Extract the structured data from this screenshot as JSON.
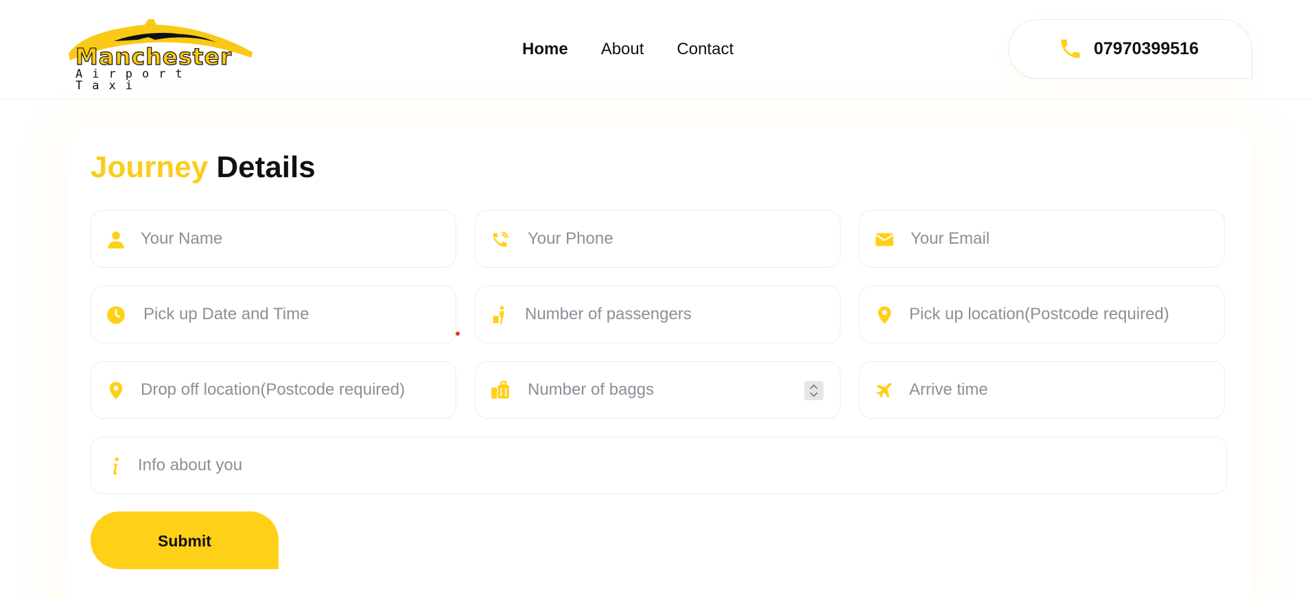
{
  "colors": {
    "accent": "#ffd018",
    "title_accent": "#fbcd1a",
    "placeholder": "#8b8f97"
  },
  "logo": {
    "title": "Manchester",
    "subtitle": "Airport Taxi"
  },
  "nav": [
    {
      "label": "Home",
      "active": true
    },
    {
      "label": "About",
      "active": false
    },
    {
      "label": "Contact",
      "active": false
    }
  ],
  "phone": {
    "icon": "phone-icon",
    "number": "07970399516"
  },
  "form": {
    "title_accent": "Journey",
    "title_rest": "Details",
    "fields": {
      "name": {
        "icon": "user-icon",
        "placeholder": "Your Name"
      },
      "phone": {
        "icon": "phone-ringing-icon",
        "placeholder": "Your Phone"
      },
      "email": {
        "icon": "envelope-icon",
        "placeholder": "Your Email"
      },
      "pickup_datetime": {
        "icon": "clock-icon",
        "placeholder": "Pick up Date and Time"
      },
      "passengers": {
        "icon": "passenger-luggage-icon",
        "placeholder": "Number of passengers"
      },
      "pickup_location": {
        "icon": "map-pin-icon",
        "placeholder": "Pick up location(Postcode required)"
      },
      "dropoff_location": {
        "icon": "map-pin-icon",
        "placeholder": "Drop off location(Postcode required)"
      },
      "baggage": {
        "icon": "suitcases-icon",
        "placeholder": "Number of baggs"
      },
      "arrive_time": {
        "icon": "plane-icon",
        "placeholder": "Arrive time"
      },
      "info": {
        "icon": "info-icon",
        "placeholder": "Info about you"
      }
    },
    "submit_label": "Submit"
  }
}
